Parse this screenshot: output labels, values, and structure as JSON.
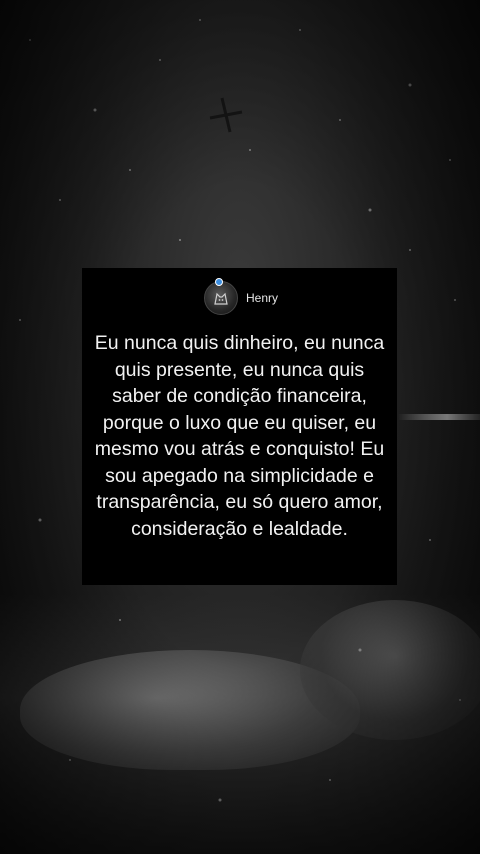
{
  "post": {
    "author": "Henry",
    "avatar_icon": "cat-avatar-icon",
    "verified_icon": "verified-badge-icon",
    "verified_color": "#3d8fe0",
    "quote": "Eu nunca quis dinheiro, eu nunca quis presente, eu nunca quis saber de condição financeira, porque o luxo que eu quiser, eu mesmo vou atrás e conquisto! Eu sou apegado na simplicidade e transparência, eu só quero amor, consideração e lealdade."
  }
}
